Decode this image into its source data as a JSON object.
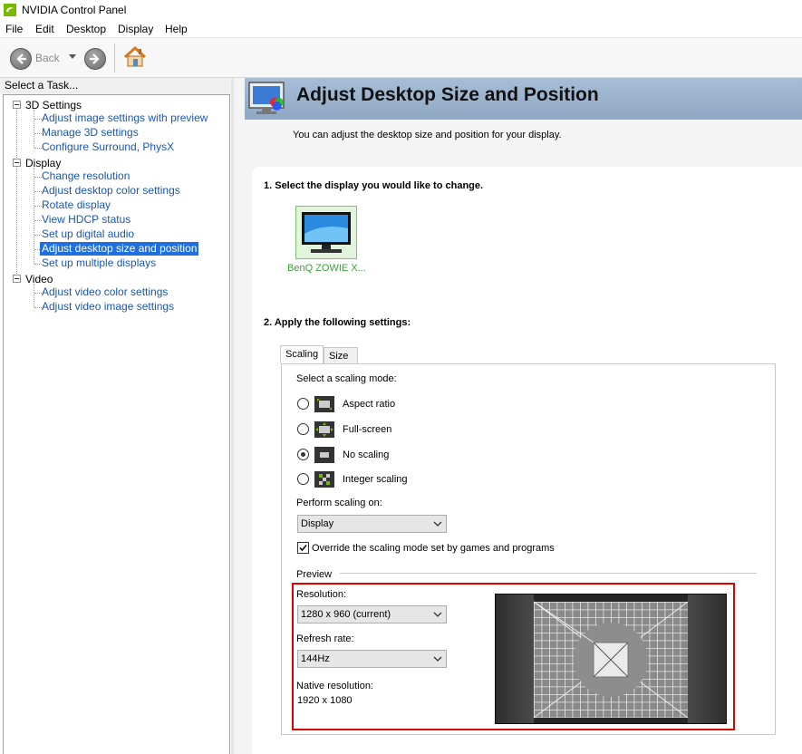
{
  "window": {
    "title": "NVIDIA Control Panel"
  },
  "menu": [
    "File",
    "Edit",
    "Desktop",
    "Display",
    "Help"
  ],
  "toolbar": {
    "back_label": "Back"
  },
  "taskpane": {
    "header": "Select a Task...",
    "categories": [
      {
        "label": "3D Settings",
        "items": [
          "Adjust image settings with preview",
          "Manage 3D settings",
          "Configure Surround, PhysX"
        ]
      },
      {
        "label": "Display",
        "items": [
          "Change resolution",
          "Adjust desktop color settings",
          "Rotate display",
          "View HDCP status",
          "Set up digital audio",
          "Adjust desktop size and position",
          "Set up multiple displays"
        ]
      },
      {
        "label": "Video",
        "items": [
          "Adjust video color settings",
          "Adjust video image settings"
        ]
      }
    ],
    "selected": "Adjust desktop size and position"
  },
  "page": {
    "title": "Adjust Desktop Size and Position",
    "description": "You can adjust the desktop size and position for your display.",
    "step1": "1. Select the display you would like to change.",
    "display_name": "BenQ ZOWIE X...",
    "step2": "2. Apply the following settings:"
  },
  "tabs": [
    "Scaling",
    "Size"
  ],
  "scaling": {
    "mode_label": "Select a scaling mode:",
    "modes": [
      "Aspect ratio",
      "Full-screen",
      "No scaling",
      "Integer scaling"
    ],
    "selected_mode": "No scaling",
    "perform_on_label": "Perform scaling on:",
    "perform_on_value": "Display",
    "override_label": "Override the scaling mode set by games and programs",
    "override_checked": true
  },
  "preview": {
    "label": "Preview",
    "resolution_label": "Resolution:",
    "resolution_value": "1280 x 960 (current)",
    "refresh_label": "Refresh rate:",
    "refresh_value": "144Hz",
    "native_label": "Native resolution:",
    "native_value": "1920 x 1080"
  },
  "colors": {
    "link": "#1a56b3",
    "selected_bg": "#1f6fe0",
    "banner": "#9fb6cf",
    "highlight": "#e00000",
    "display_label": "#3aa13a"
  }
}
